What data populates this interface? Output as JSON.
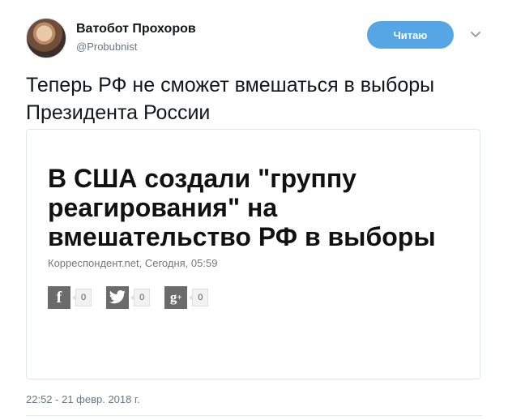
{
  "header": {
    "name": "Ватобот Прохоров",
    "handle": "@Probubnist",
    "follow_label": "Читаю",
    "avatar_icon": "user-avatar",
    "chevron_icon": "chevron-down-icon",
    "accent_color": "#56a6e6"
  },
  "tweet": {
    "text": "Теперь РФ не сможет вмешаться в выборы Президента России",
    "timestamp": "22:52 - 21 февр. 2018 г."
  },
  "card": {
    "title": "В США создали \"группу реагирования\" на вмешательство РФ в выборы",
    "meta": "Корреспондент.net, Сегодня, 05:59",
    "shares": [
      {
        "icon": "facebook-icon",
        "glyph": "f",
        "count": "0"
      },
      {
        "icon": "twitter-icon",
        "glyph": "🐦",
        "count": "0"
      },
      {
        "icon": "google-plus-icon",
        "glyph": "g+",
        "count": "0"
      }
    ]
  }
}
